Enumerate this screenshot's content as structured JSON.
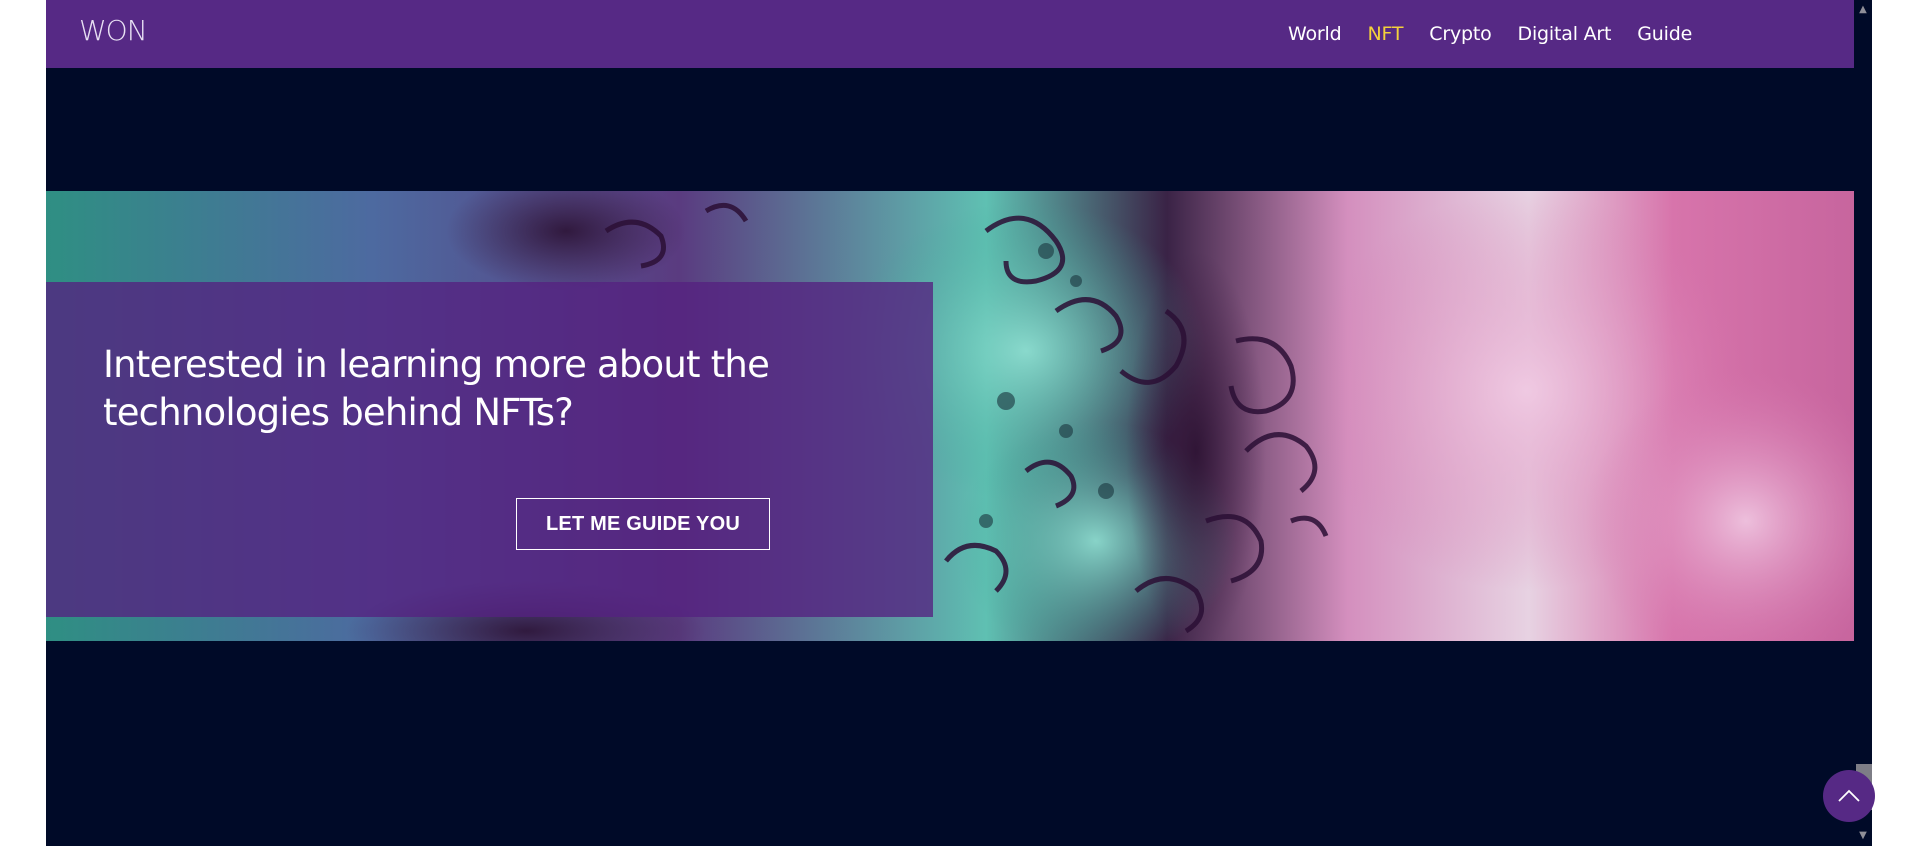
{
  "logo": {
    "text": "WON"
  },
  "nav": {
    "items": [
      {
        "label": "World"
      },
      {
        "label": "NFT"
      },
      {
        "label": "Crypto"
      },
      {
        "label": "Digital Art"
      },
      {
        "label": "Guide"
      }
    ],
    "active_index": 1
  },
  "hero": {
    "headline": "Interested in learning more about the technologies behind NFTs?",
    "cta_label": "LET ME GUIDE YOU"
  },
  "icons": {
    "to_top": "chevron-up-icon",
    "scroll_up": "scroll-up-arrow-icon",
    "scroll_down": "scroll-down-arrow-icon"
  },
  "colors": {
    "navbar": "#562985",
    "page_background": "#000a28",
    "active_nav": "#f4d13b",
    "overlay": "#552180"
  }
}
